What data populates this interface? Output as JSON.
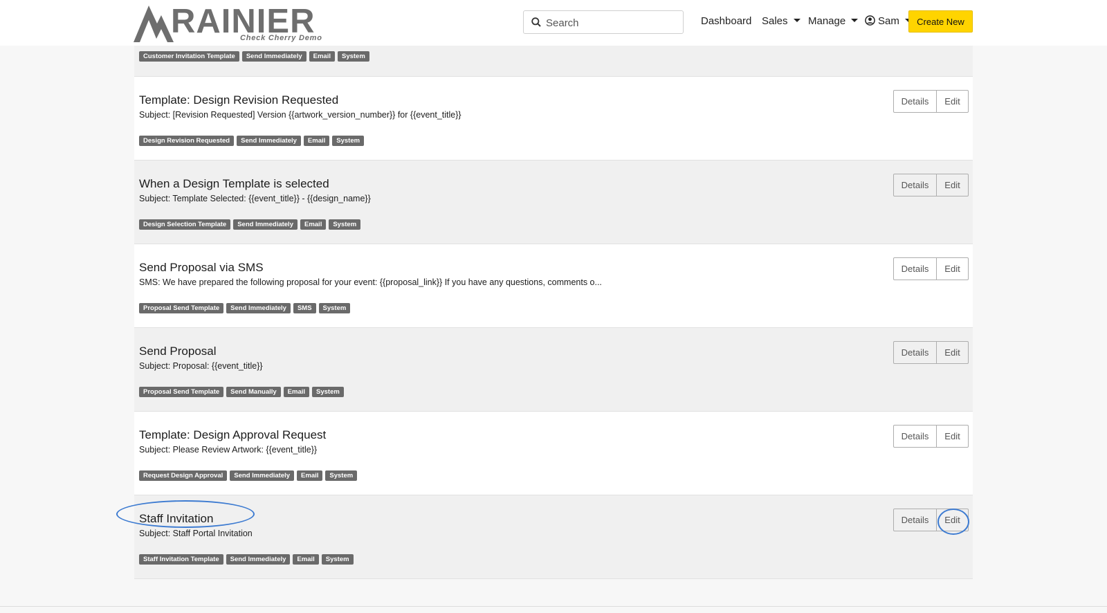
{
  "header": {
    "logo_text": "RAINIER",
    "logo_subtitle": "Check Cherry Demo",
    "search_placeholder": "Search",
    "nav": {
      "dashboard": "Dashboard",
      "sales": "Sales",
      "manage": "Manage",
      "user": "Sam"
    },
    "create_new": "Create New"
  },
  "list": {
    "details_label": "Details",
    "edit_label": "Edit",
    "top_partial_tags": [
      "Customer Invitation Template",
      "Send Immediately",
      "Email",
      "System"
    ],
    "rows": [
      {
        "title": "Template: Design Revision Requested",
        "subject": "Subject: [Revision Requested] Version {{artwork_version_number}} for {{event_title}}",
        "tags": [
          "Design Revision Requested",
          "Send Immediately",
          "Email",
          "System"
        ]
      },
      {
        "title": "When a Design Template is selected",
        "subject": "Subject: Template Selected: {{event_title}} - {{design_name}}",
        "tags": [
          "Design Selection Template",
          "Send Immediately",
          "Email",
          "System"
        ]
      },
      {
        "title": "Send Proposal via SMS",
        "subject": "SMS: We have prepared the following proposal for your event: {{proposal_link}} If you have any questions, comments o...",
        "tags": [
          "Proposal Send Template",
          "Send Immediately",
          "SMS",
          "System"
        ]
      },
      {
        "title": "Send Proposal",
        "subject": "Subject: Proposal: {{event_title}}",
        "tags": [
          "Proposal Send Template",
          "Send Manually",
          "Email",
          "System"
        ]
      },
      {
        "title": "Template: Design Approval Request",
        "subject": "Subject: Please Review Artwork: {{event_title}}",
        "tags": [
          "Request Design Approval",
          "Send Immediately",
          "Email",
          "System"
        ]
      },
      {
        "title": "Staff Invitation",
        "subject": "Subject: Staff Portal Invitation",
        "tags": [
          "Staff Invitation Template",
          "Send Immediately",
          "Email",
          "System"
        ]
      }
    ]
  },
  "colors": {
    "accent_button": "#ffd400",
    "tag_background": "#6a6a6a",
    "annotation": "#3d7bd1"
  }
}
